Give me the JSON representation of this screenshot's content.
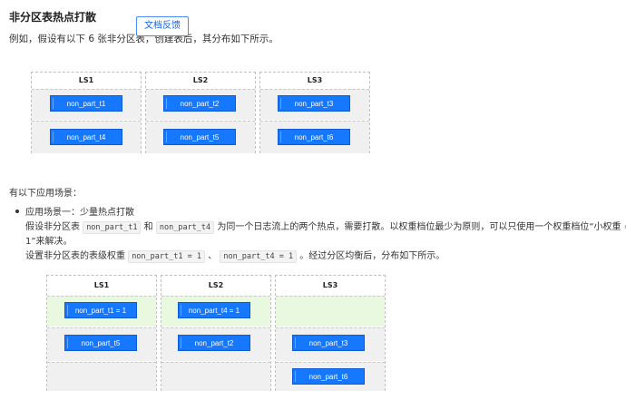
{
  "doc": {
    "title": "非分区表热点打散",
    "feedback_label": "文档反馈",
    "intro": "例如，假设有以下 6 张非分区表，创建表后，其分布如下所示。",
    "scenarios_label": "有以下应用场景：",
    "bullet_title": "应用场景一：少量热点打散",
    "para1_a": "假设非分区表",
    "para1_code1": "non_part_t1",
    "para1_b": "和",
    "para1_code2": "non_part_t4",
    "para1_c": "为同一个日志流上的两个热点，需要打散。以权重档位最少为原则，可以只使用一个权重档位“小权重 =",
    "para2": "1”来解决。",
    "para3_a": "设置非分区表的表级权重",
    "para3_code1": "non_part_t1 = 1",
    "para3_b": "、",
    "para3_code2": "non_part_t4 = 1",
    "para3_c": "。经过分区均衡后，分布如下所示。"
  },
  "diagram1": {
    "groups": [
      {
        "name": "LS1",
        "rows": [
          "non_part_t1",
          "non_part_t4"
        ]
      },
      {
        "name": "LS2",
        "rows": [
          "non_part_t2",
          "non_part_t5"
        ]
      },
      {
        "name": "LS3",
        "rows": [
          "non_part_t3",
          "non_part_t6"
        ]
      }
    ]
  },
  "diagram2": {
    "groups": [
      {
        "name": "LS1",
        "rows": [
          "non_part_t1 = 1",
          "non_part_t5",
          ""
        ]
      },
      {
        "name": "LS2",
        "rows": [
          "non_part_t4 = 1",
          "non_part_t2",
          ""
        ]
      },
      {
        "name": "LS3",
        "rows": [
          "",
          "non_part_t3",
          "non_part_t6"
        ]
      }
    ]
  },
  "colors": {
    "chip_fill": "#1677ff",
    "cell_gray": "#f0f0f0",
    "cell_green": "#e8f9df",
    "link_blue": "#1366ec"
  }
}
